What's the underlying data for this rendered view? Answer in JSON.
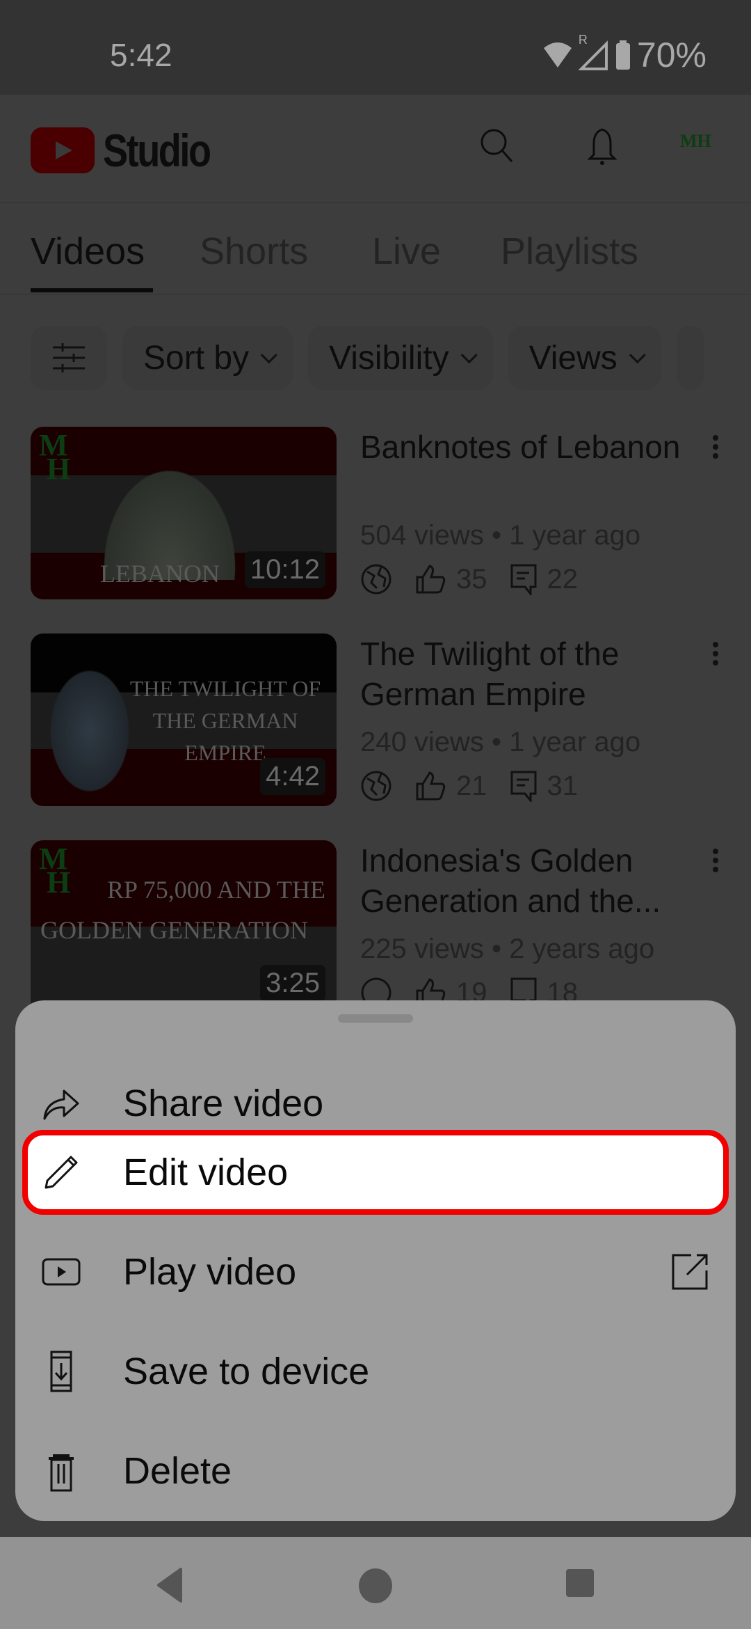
{
  "status_bar": {
    "time": "5:42",
    "battery": "70%",
    "signal_label": "R"
  },
  "app_bar": {
    "title": "Studio",
    "avatar_text": "MH"
  },
  "tabs": [
    {
      "label": "Videos",
      "active": true
    },
    {
      "label": "Shorts",
      "active": false
    },
    {
      "label": "Live",
      "active": false
    },
    {
      "label": "Playlists",
      "active": false
    }
  ],
  "filters": {
    "sort_label": "Sort by",
    "visibility_label": "Visibility",
    "views_label": "Views"
  },
  "videos": [
    {
      "title": "Banknotes of Lebanon",
      "meta": "504 views • 1 year ago",
      "duration": "10:12",
      "likes": "35",
      "comments": "22",
      "thumb_text": "LEBANON"
    },
    {
      "title": "The Twilight of the German Empire",
      "meta": "240 views • 1 year ago",
      "duration": "4:42",
      "likes": "21",
      "comments": "31",
      "thumb_text": "THE TWILIGHT OF THE GERMAN EMPIRE"
    },
    {
      "title": "Indonesia's Golden Generation and the...",
      "meta": "225 views • 2 years ago",
      "duration": "3:25",
      "likes": "19",
      "comments": "18",
      "thumb_text": "RP 75,000 AND THE GOLDEN GENERATION"
    }
  ],
  "sheet": {
    "items": [
      {
        "label": "Share video",
        "icon": "share-icon"
      },
      {
        "label": "Edit video",
        "icon": "pencil-icon",
        "highlighted": true
      },
      {
        "label": "Play video",
        "icon": "play-icon",
        "trailing_icon": "open-external-icon"
      },
      {
        "label": "Save to device",
        "icon": "download-to-device-icon"
      },
      {
        "label": "Delete",
        "icon": "trash-icon"
      }
    ]
  },
  "colors": {
    "highlight_border": "#f20000",
    "sheet_bg": "#9d9d9d",
    "scrim_bg": "#3d3d3d"
  }
}
